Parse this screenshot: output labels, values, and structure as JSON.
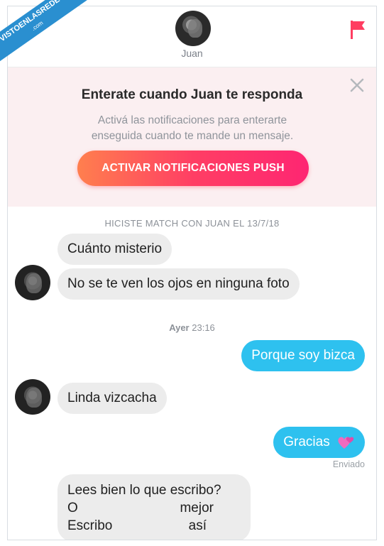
{
  "header": {
    "contact_name": "Juan"
  },
  "notification": {
    "title": "Enterate cuando Juan te responda",
    "body": "Activá las notificaciones para enterarte enseguida cuando te mande un mensaje.",
    "button_label": "ACTIVAR NOTIFICACIONES PUSH"
  },
  "chat": {
    "match_text": "HICISTE MATCH CON JUAN EL 13/7/18",
    "timestamp_day": "Ayer",
    "timestamp_time": "23:16",
    "messages": [
      {
        "from": "Juan",
        "text": "Cuánto misterio"
      },
      {
        "from": "Juan",
        "text": "No se te ven los ojos en ninguna foto"
      },
      {
        "from": "me",
        "text": "Porque soy bizca"
      },
      {
        "from": "Juan",
        "text": "Linda vizcacha"
      },
      {
        "from": "me",
        "text": "Gracias"
      },
      {
        "from": "Juan",
        "lines": [
          [
            "Lees  bien lo que escribo?"
          ],
          [
            "O",
            "mejor"
          ],
          [
            "Escribo",
            "así"
          ]
        ]
      }
    ],
    "sent_status": "Enviado"
  },
  "watermark": {
    "text": "VISTOENLASREDES",
    "suffix": ".com"
  },
  "colors": {
    "incoming_bubble": "#ececec",
    "outgoing_bubble": "#2ec1ef",
    "accent_gradient_start": "#ff7f4e",
    "accent_gradient_end": "#fe2672",
    "banner_bg": "#fbeff1",
    "flag": "#ff3d61"
  }
}
